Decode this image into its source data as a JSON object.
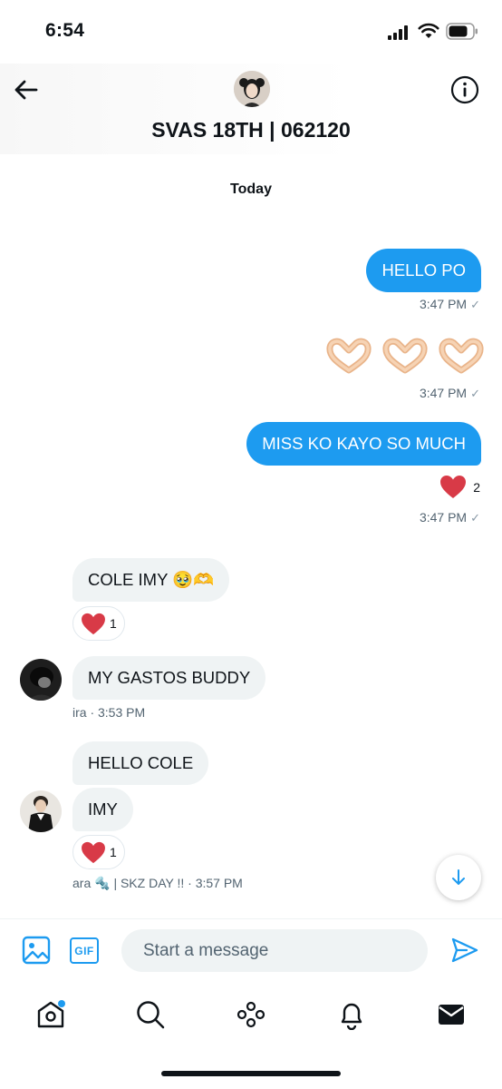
{
  "status_bar": {
    "time": "6:54"
  },
  "header": {
    "title": "SVAS 18TH | 062120",
    "back_icon": "arrow-left-icon",
    "info_icon": "info-icon"
  },
  "conversation": {
    "day_label": "Today",
    "sent": [
      {
        "text": "HELLO PO",
        "time": "3:47 PM"
      },
      {
        "emoji": [
          "🫶",
          "🫶",
          "🫶"
        ],
        "time": "3:47 PM"
      },
      {
        "text": "MISS KO KAYO SO MUCH",
        "reaction_count": "2",
        "time": "3:47 PM"
      }
    ],
    "received": [
      {
        "text": "COLE IMY 🥹🫶",
        "reaction_count": "1"
      },
      {
        "text": "MY GASTOS BUDDY",
        "meta": "ira · 3:53 PM"
      },
      {
        "text": "HELLO COLE"
      },
      {
        "text": "IMY",
        "reaction_count": "1",
        "meta": "ara 🔩 | SKZ DAY !!  · 3:57 PM"
      }
    ]
  },
  "composer": {
    "placeholder": "Start a message",
    "gif_label": "GIF",
    "accent_color": "#1d9bf0"
  },
  "colors": {
    "sent_bubble": "#1d9bf0",
    "received_bubble": "#eff3f4",
    "reaction_heart": "#d83a47",
    "meta_text": "#536471"
  }
}
